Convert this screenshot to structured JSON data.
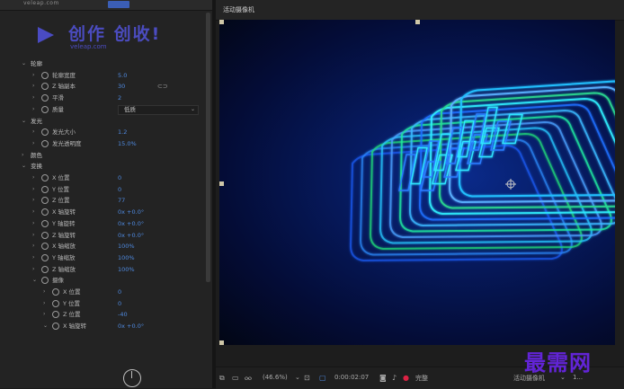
{
  "left_panel": {
    "tab_text": "veleap.com",
    "logo_title": "创作 创收!",
    "logo_sub": "veleap.com",
    "rows": [
      {
        "level": 0,
        "twirl": "⌄",
        "label": "轮廓",
        "value": ""
      },
      {
        "level": 1,
        "twirl": "›",
        "label": "轮廓宽度",
        "value": "5.0"
      },
      {
        "level": 1,
        "twirl": "›",
        "label": "Z 轴副本",
        "value": "30",
        "link": "⊂⊃"
      },
      {
        "level": 1,
        "twirl": "›",
        "label": "平滑",
        "value": "2"
      },
      {
        "level": 1,
        "twirl": "›",
        "label": "质量",
        "value": "",
        "dropdown": "低质"
      },
      {
        "level": 0,
        "twirl": "⌄",
        "label": "发光",
        "value": ""
      },
      {
        "level": 1,
        "twirl": "›",
        "label": "发光大小",
        "value": "1.2"
      },
      {
        "level": 1,
        "twirl": "›",
        "label": "发光透明度",
        "value": "15.0%"
      },
      {
        "level": 0,
        "twirl": "›",
        "label": "颜色",
        "value": ""
      },
      {
        "level": 0,
        "twirl": "⌄",
        "label": "变换",
        "value": ""
      },
      {
        "level": 1,
        "twirl": "›",
        "label": "X 位置",
        "value": "0"
      },
      {
        "level": 1,
        "twirl": "›",
        "label": "Y 位置",
        "value": "0"
      },
      {
        "level": 1,
        "twirl": "›",
        "label": "Z 位置",
        "value": "77"
      },
      {
        "level": 1,
        "twirl": "›",
        "label": "X 轴旋转",
        "value": "0x +0.0°"
      },
      {
        "level": 1,
        "twirl": "›",
        "label": "Y 轴旋转",
        "value": "0x +0.0°"
      },
      {
        "level": 1,
        "twirl": "›",
        "label": "Z 轴旋转",
        "value": "0x +0.0°"
      },
      {
        "level": 1,
        "twirl": "›",
        "label": "X 轴缩放",
        "value": "100%"
      },
      {
        "level": 1,
        "twirl": "›",
        "label": "Y 轴缩放",
        "value": "100%"
      },
      {
        "level": 1,
        "twirl": "›",
        "label": "Z 轴缩放",
        "value": "100%"
      },
      {
        "level": 1,
        "twirl": "⌄",
        "label": "摄像",
        "value": ""
      },
      {
        "level": 2,
        "twirl": "›",
        "label": "X 位置",
        "value": "0"
      },
      {
        "level": 2,
        "twirl": "›",
        "label": "Y 位置",
        "value": "0"
      },
      {
        "level": 2,
        "twirl": "›",
        "label": "Z 位置",
        "value": "-40"
      },
      {
        "level": 2,
        "twirl": "⌄",
        "label": "X 轴旋转",
        "value": "0x +0.0°"
      }
    ]
  },
  "viewer": {
    "title": "活动摄像机"
  },
  "footer": {
    "zoom": "(46.6%)",
    "timecode": "0:00:02:07",
    "quality": "完整",
    "camera": "活动摄像机",
    "views": "1..."
  },
  "watermark": "最需网",
  "colors": {
    "accent_blue": "#4f8ae0",
    "brand_purple": "#4b4cc0",
    "watermark_purple": "#6224d6"
  }
}
